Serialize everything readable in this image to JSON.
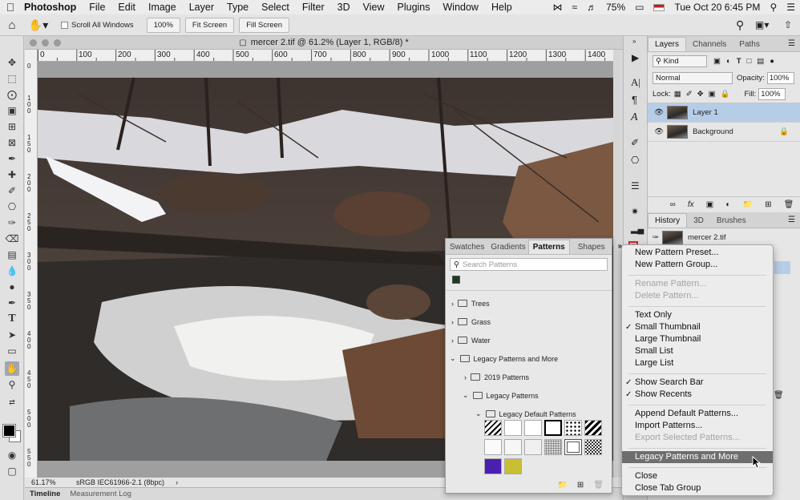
{
  "menubar": {
    "app": "Photoshop",
    "items": [
      "File",
      "Edit",
      "Image",
      "Layer",
      "Type",
      "Select",
      "Filter",
      "3D",
      "View",
      "Plugins",
      "Window",
      "Help"
    ],
    "battery": "75%",
    "clock": "Tue Oct 20  6:45 PM"
  },
  "options": {
    "scroll_all_windows": "Scroll All Windows",
    "zoom_100": "100%",
    "fit_screen": "Fit Screen",
    "fill_screen": "Fill Screen"
  },
  "document": {
    "title": "mercer 2.tif @ 61.2% (Layer 1, RGB/8) *",
    "ruler_ticks": [
      "0",
      "100",
      "200",
      "300",
      "400",
      "500",
      "600",
      "700",
      "800",
      "900",
      "1000",
      "1100",
      "1200",
      "1300",
      "1400"
    ],
    "vruler_ticks": [
      "0",
      "1",
      "0",
      "0",
      "1",
      "5",
      "0",
      "2",
      "0",
      "0",
      "2",
      "5",
      "0",
      "3",
      "0",
      "0",
      "3",
      "5",
      "0",
      "4",
      "0",
      "0",
      "4",
      "5",
      "0",
      "5",
      "0",
      "0",
      "5",
      "5",
      "0"
    ],
    "zoom": "61.17%",
    "profile": "sRGB IEC61966-2.1 (8bpc)"
  },
  "bottom_tabs": [
    "Timeline",
    "Measurement Log"
  ],
  "layers_panel": {
    "tabs": [
      "Layers",
      "Channels",
      "Paths"
    ],
    "filter_kind": "Kind",
    "blend_mode": "Normal",
    "opacity_label": "Opacity:",
    "opacity_value": "100%",
    "lock_label": "Lock:",
    "fill_label": "Fill:",
    "fill_value": "100%",
    "layers": [
      "Layer 1",
      "Background"
    ]
  },
  "history_panel": {
    "tabs": [
      "History",
      "3D",
      "Brushes"
    ],
    "item": "mercer 2.tif"
  },
  "patterns_panel": {
    "tabs": [
      "Swatches",
      "Gradients",
      "Patterns",
      "Shapes"
    ],
    "search_placeholder": "Search Patterns",
    "groups": [
      "Trees",
      "Grass",
      "Water",
      "Legacy Patterns and More",
      "2019 Patterns",
      "Legacy Patterns",
      "Legacy Default Patterns"
    ],
    "swatch_colors": [
      "#ffffff",
      "#000000",
      "#5522aa",
      "#c8c030"
    ]
  },
  "flyout_menu": {
    "items": [
      {
        "label": "New Pattern Preset...",
        "disabled": false
      },
      {
        "label": "New Pattern Group...",
        "disabled": false
      },
      {
        "label": "Rename Pattern...",
        "disabled": true
      },
      {
        "label": "Delete Pattern...",
        "disabled": true
      },
      {
        "label": "Text Only",
        "disabled": false
      },
      {
        "label": "Small Thumbnail",
        "disabled": false,
        "checked": true
      },
      {
        "label": "Large Thumbnail",
        "disabled": false
      },
      {
        "label": "Small List",
        "disabled": false
      },
      {
        "label": "Large List",
        "disabled": false
      },
      {
        "label": "Show Search Bar",
        "disabled": false,
        "checked": true
      },
      {
        "label": "Show Recents",
        "disabled": false,
        "checked": true
      },
      {
        "label": "Append Default Patterns...",
        "disabled": false
      },
      {
        "label": "Import Patterns...",
        "disabled": false
      },
      {
        "label": "Export Selected Patterns...",
        "disabled": true
      },
      {
        "label": "Legacy Patterns and More",
        "disabled": false,
        "highlighted": true
      },
      {
        "label": "Close",
        "disabled": false
      },
      {
        "label": "Close Tab Group",
        "disabled": false
      }
    ],
    "checkmark": "✓"
  }
}
